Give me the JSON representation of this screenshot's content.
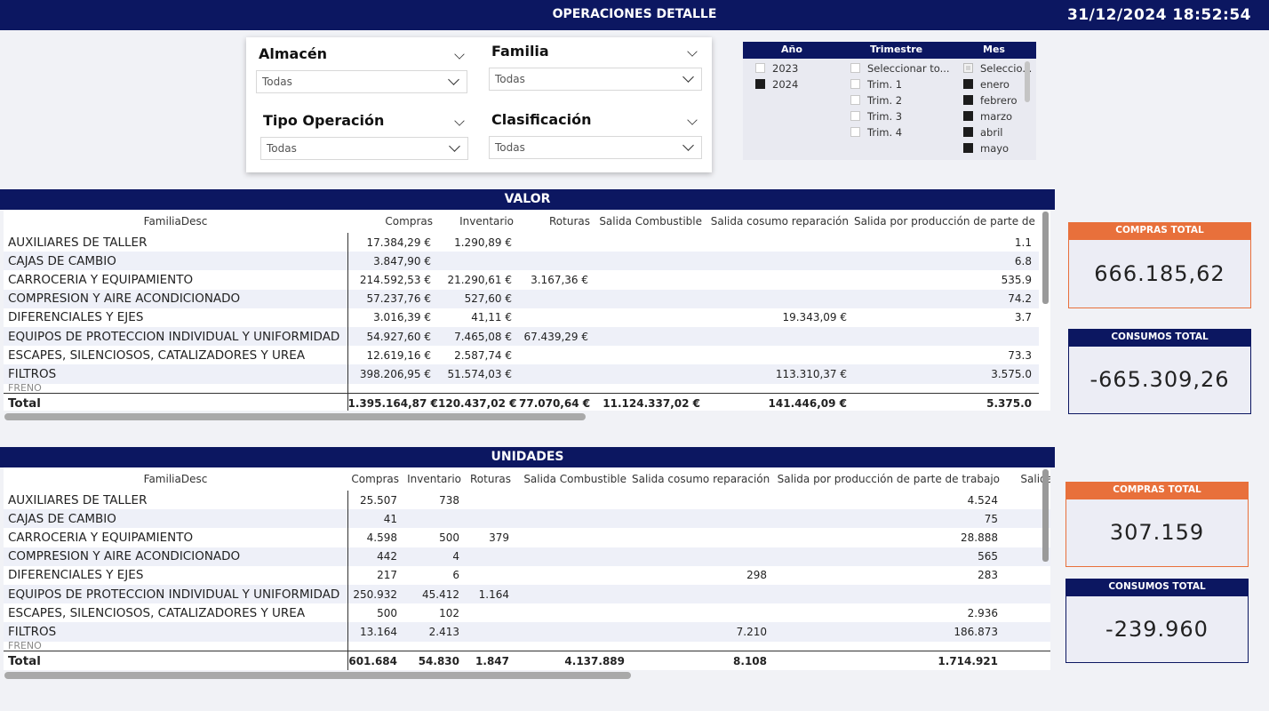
{
  "header": {
    "title": "OPERACIONES DETALLE",
    "datetime": "31/12/2024 18:52:54"
  },
  "filters": {
    "almacen": {
      "label": "Almacén",
      "value": "Todas"
    },
    "familia": {
      "label": "Familia",
      "value": "Todas"
    },
    "tipo_operacion": {
      "label": "Tipo Operación",
      "value": "Todas"
    },
    "clasificacion": {
      "label": "Clasificación",
      "value": "Todas"
    }
  },
  "date_slicer": {
    "headers": {
      "year": "Año",
      "quarter": "Trimestre",
      "month": "Mes"
    },
    "years": [
      {
        "label": "2023",
        "checked": false
      },
      {
        "label": "2024",
        "checked": true
      }
    ],
    "quarters": [
      {
        "label": "Seleccionar to...",
        "checked": false
      },
      {
        "label": "Trim. 1",
        "checked": false
      },
      {
        "label": "Trim. 2",
        "checked": false
      },
      {
        "label": "Trim. 3",
        "checked": false
      },
      {
        "label": "Trim. 4",
        "checked": false
      }
    ],
    "months": [
      {
        "label": "Seleccio...",
        "checked": "partial"
      },
      {
        "label": "enero",
        "checked": true
      },
      {
        "label": "febrero",
        "checked": true
      },
      {
        "label": "marzo",
        "checked": true
      },
      {
        "label": "abril",
        "checked": true
      },
      {
        "label": "mayo",
        "checked": true
      }
    ]
  },
  "valor": {
    "title": "VALOR",
    "columns": [
      "FamiliaDesc",
      "Compras",
      "Inventario",
      "Roturas",
      "Salida Combustible",
      "Salida cosumo reparación",
      "Salida por producción de parte de"
    ],
    "rows": [
      [
        "AUXILIARES DE TALLER",
        "17.384,29 €",
        "1.290,89 €",
        "",
        "",
        "",
        "1.1"
      ],
      [
        "CAJAS DE CAMBIO",
        "3.847,90 €",
        "",
        "",
        "",
        "",
        "6.8"
      ],
      [
        "CARROCERIA Y EQUIPAMIENTO",
        "214.592,53 €",
        "21.290,61 €",
        "3.167,36 €",
        "",
        "",
        "535.9"
      ],
      [
        "COMPRESION Y AIRE ACONDICIONADO",
        "57.237,76 €",
        "527,60 €",
        "",
        "",
        "",
        "74.2"
      ],
      [
        "DIFERENCIALES Y EJES",
        "3.016,39 €",
        "41,11 €",
        "",
        "",
        "19.343,09 €",
        "3.7"
      ],
      [
        "EQUIPOS DE PROTECCION INDIVIDUAL Y UNIFORMIDAD",
        "54.927,60 €",
        "7.465,08 €",
        "67.439,29 €",
        "",
        "",
        ""
      ],
      [
        "ESCAPES, SILENCIOSOS, CATALIZADORES Y UREA",
        "12.619,16 €",
        "2.587,74 €",
        "",
        "",
        "",
        "73.3"
      ],
      [
        "FILTROS",
        "398.206,95 €",
        "51.574,03 €",
        "",
        "",
        "113.310,37 €",
        "3.575.0"
      ]
    ],
    "cut_row": [
      "FRENO",
      "",
      "",
      "",
      "",
      "",
      ""
    ],
    "total": [
      "Total",
      "1.395.164,87 €",
      "120.437,02 €",
      "77.070,64 €",
      "11.124.337,02 €",
      "141.446,09 €",
      "5.375.0"
    ]
  },
  "unidades": {
    "title": "UNIDADES",
    "columns": [
      "FamiliaDesc",
      "Compras",
      "Inventario",
      "Roturas",
      "Salida Combustible",
      "Salida cosumo reparación",
      "Salida por producción de parte de trabajo",
      "Salida"
    ],
    "rows": [
      [
        "AUXILIARES DE TALLER",
        "25.507",
        "738",
        "",
        "",
        "",
        "4.524",
        ""
      ],
      [
        "CAJAS DE CAMBIO",
        "41",
        "",
        "",
        "",
        "",
        "75",
        ""
      ],
      [
        "CARROCERIA Y EQUIPAMIENTO",
        "4.598",
        "500",
        "379",
        "",
        "",
        "28.888",
        ""
      ],
      [
        "COMPRESION Y AIRE ACONDICIONADO",
        "442",
        "4",
        "",
        "",
        "",
        "565",
        ""
      ],
      [
        "DIFERENCIALES Y EJES",
        "217",
        "6",
        "",
        "",
        "298",
        "283",
        ""
      ],
      [
        "EQUIPOS DE PROTECCION INDIVIDUAL Y UNIFORMIDAD",
        "250.932",
        "45.412",
        "1.164",
        "",
        "",
        "",
        ""
      ],
      [
        "ESCAPES, SILENCIOSOS, CATALIZADORES Y UREA",
        "500",
        "102",
        "",
        "",
        "",
        "2.936",
        ""
      ],
      [
        "FILTROS",
        "13.164",
        "2.413",
        "",
        "",
        "7.210",
        "186.873",
        ""
      ]
    ],
    "cut_row": [
      "FRENO",
      "",
      "",
      "",
      "",
      "",
      "",
      ""
    ],
    "total": [
      "Total",
      "601.684",
      "54.830",
      "1.847",
      "4.137.889",
      "8.108",
      "1.714.921",
      ""
    ]
  },
  "cards": {
    "valor_compras": {
      "label": "COMPRAS TOTAL",
      "value": "666.185,62",
      "color": "#e8703b"
    },
    "valor_consumos": {
      "label": "CONSUMOS TOTAL",
      "value": "-665.309,26",
      "color": "#0c1761"
    },
    "unid_compras": {
      "label": "COMPRAS TOTAL",
      "value": "307.159",
      "color": "#e8703b"
    },
    "unid_consumos": {
      "label": "CONSUMOS TOTAL",
      "value": "-239.960",
      "color": "#0c1761"
    }
  }
}
